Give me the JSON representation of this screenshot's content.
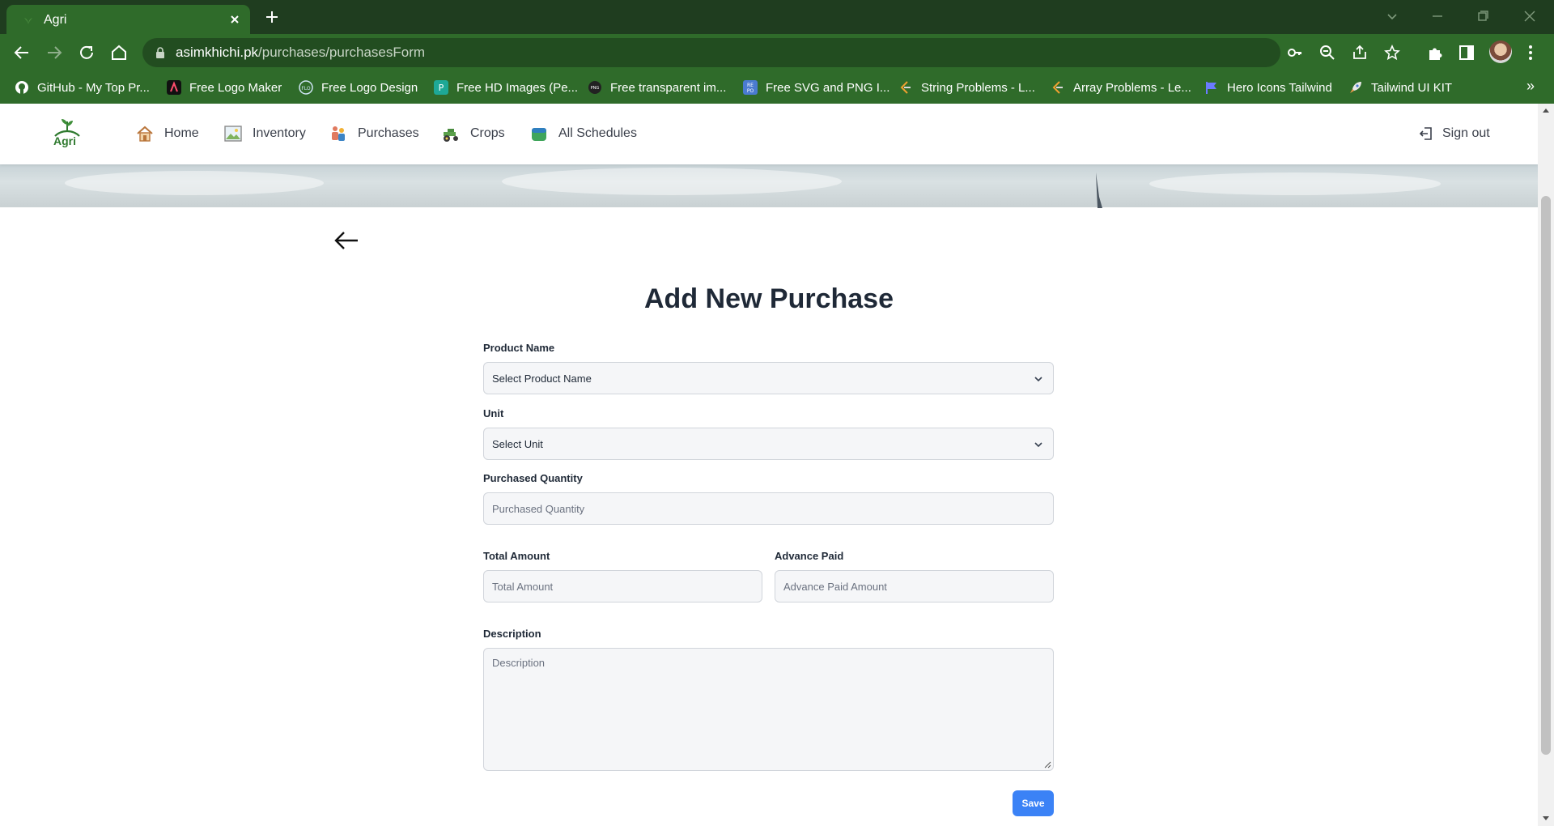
{
  "browser": {
    "tab_title": "Agri",
    "url_domain": "asimkhichi.pk",
    "url_path": "/purchases/purchasesForm",
    "bookmarks": [
      {
        "label": "GitHub - My Top Pr...",
        "icon": "github-icon",
        "color": "#ffffff"
      },
      {
        "label": "Free Logo Maker",
        "icon": "logo-maker-icon",
        "color": "#111111"
      },
      {
        "label": "Free Logo Design",
        "icon": "flo-icon",
        "color": "#6aa7d8"
      },
      {
        "label": "Free HD Images (Pe...",
        "icon": "pexels-icon",
        "color": "#1ea896"
      },
      {
        "label": "Free transparent im...",
        "icon": "png-icon",
        "color": "#222222"
      },
      {
        "label": "Free SVG and PNG I...",
        "icon": "svgrepo-icon",
        "color": "#4a7bd0"
      },
      {
        "label": "String Problems - L...",
        "icon": "leetcode-icon",
        "color": "#f0a030"
      },
      {
        "label": "Array Problems - Le...",
        "icon": "leetcode-icon",
        "color": "#f0a030"
      },
      {
        "label": "Hero Icons Tailwind",
        "icon": "flag-icon",
        "color": "#6b7bff"
      },
      {
        "label": "Tailwind UI KIT",
        "icon": "rocket-icon",
        "color": "#f2c94c"
      }
    ],
    "bookmarks_more": "»"
  },
  "app": {
    "logo_text": "Agri",
    "nav": [
      {
        "label": "Home",
        "icon": "house-icon"
      },
      {
        "label": "Inventory",
        "icon": "picture-icon"
      },
      {
        "label": "Purchases",
        "icon": "people-icon"
      },
      {
        "label": "Crops",
        "icon": "tractor-icon"
      },
      {
        "label": "All Schedules",
        "icon": "calendar-icon"
      }
    ],
    "sign_out": "Sign out"
  },
  "form": {
    "title": "Add New Purchase",
    "product_name": {
      "label": "Product Name",
      "value": "Select Product Name"
    },
    "unit": {
      "label": "Unit",
      "value": "Select Unit"
    },
    "purchased_quantity": {
      "label": "Purchased Quantity",
      "placeholder": "Purchased Quantity"
    },
    "total_amount": {
      "label": "Total Amount",
      "placeholder": "Total Amount"
    },
    "advance_paid": {
      "label": "Advance Paid",
      "placeholder": "Advance Paid Amount"
    },
    "description": {
      "label": "Description",
      "placeholder": "Description"
    },
    "save_label": "Save"
  },
  "colors": {
    "chrome_dark": "#1f3d1f",
    "chrome": "#2f6b2a",
    "accent_button": "#3b82f6"
  }
}
